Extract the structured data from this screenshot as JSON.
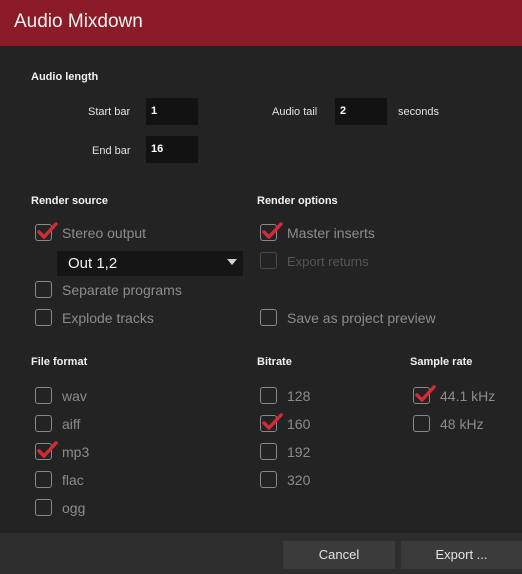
{
  "dialog": {
    "title": "Audio Mixdown"
  },
  "audio_length": {
    "heading": "Audio length",
    "start_bar_label": "Start bar",
    "start_bar_value": "1",
    "end_bar_label": "End bar",
    "end_bar_value": "16",
    "audio_tail_label": "Audio tail",
    "audio_tail_value": "2",
    "seconds_label": "seconds"
  },
  "render_source": {
    "heading": "Render source",
    "stereo_output": {
      "label": "Stereo output",
      "checked": true
    },
    "output_select": {
      "value": "Out 1,2"
    },
    "separate_programs": {
      "label": "Separate programs",
      "checked": false
    },
    "explode_tracks": {
      "label": "Explode tracks",
      "checked": false
    }
  },
  "render_options": {
    "heading": "Render options",
    "master_inserts": {
      "label": "Master inserts",
      "checked": true
    },
    "export_returns": {
      "label": "Export returns",
      "checked": false,
      "disabled": true
    },
    "save_preview": {
      "label": "Save as project preview",
      "checked": false
    }
  },
  "file_format": {
    "heading": "File format",
    "options": [
      {
        "label": "wav",
        "checked": false
      },
      {
        "label": "aiff",
        "checked": false
      },
      {
        "label": "mp3",
        "checked": true
      },
      {
        "label": "flac",
        "checked": false
      },
      {
        "label": "ogg",
        "checked": false
      }
    ]
  },
  "bitrate": {
    "heading": "Bitrate",
    "options": [
      {
        "label": "128",
        "checked": false
      },
      {
        "label": "160",
        "checked": true
      },
      {
        "label": "192",
        "checked": false
      },
      {
        "label": "320",
        "checked": false
      }
    ]
  },
  "sample_rate": {
    "heading": "Sample rate",
    "options": [
      {
        "label": "44.1 kHz",
        "checked": true
      },
      {
        "label": "48 kHz",
        "checked": false
      }
    ]
  },
  "footer": {
    "cancel_label": "Cancel",
    "export_label": "Export ..."
  },
  "colors": {
    "title_bar": "#8b1b26",
    "check_mark": "#d42a37",
    "background": "#232323"
  }
}
